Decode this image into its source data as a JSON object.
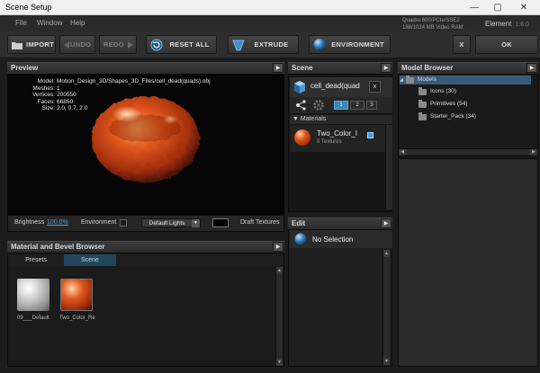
{
  "window": {
    "title": "Scene Setup",
    "minimize": "—",
    "maximize": "▢",
    "close": "✕"
  },
  "menu": [
    "File",
    "Window",
    "Help"
  ],
  "gpu": {
    "line1": "Quadro 600/PCIe/SSE2",
    "line2": "188/1024 MB Video RAM"
  },
  "element": {
    "name": "Element",
    "version": "1.6.0"
  },
  "toolbar": {
    "import": "IMPORT",
    "undo": "UNDO",
    "redo": "REDO",
    "reset_all": "RESET ALL",
    "extrude": "EXTRUDE",
    "environment": "ENVIRONMENT",
    "x": "X",
    "ok": "OK"
  },
  "preview": {
    "title": "Preview",
    "info": [
      {
        "k": "Model:",
        "v": "Motion_Design_3D/Shapes_3D_Files/cell_dead(quads).obj"
      },
      {
        "k": "Meshes:",
        "v": "1"
      },
      {
        "k": "Vertices:",
        "v": "200550"
      },
      {
        "k": "Faces:",
        "v": "66850"
      },
      {
        "k": "Size:",
        "v": "2.0, 0.7, 2.0"
      }
    ],
    "brightness_label": "Brightness",
    "brightness_value": "100.0%",
    "environment_label": "Environment",
    "lights": "Default Lights",
    "draft_textures": "Draft Textures"
  },
  "material_browser": {
    "title": "Material and Bevel Browser",
    "tabs": [
      "Presets",
      "Scene"
    ],
    "active_tab": "Scene",
    "items": [
      {
        "label": "09___Default"
      },
      {
        "label": "Two_Color_Re"
      }
    ]
  },
  "scene": {
    "title": "Scene",
    "object_name": "cell_dead(quad",
    "close": "x",
    "segments": [
      "1",
      "2",
      "3"
    ],
    "materials_label": "Materials",
    "material": {
      "name": "Two_Color_I",
      "sub": "0 Textures"
    }
  },
  "edit": {
    "title": "Edit",
    "status": "No Selection"
  },
  "model_browser": {
    "title": "Model Browser",
    "root": "Models",
    "children": [
      "Icons (30)",
      "Primitives (54)",
      "Starter_Pack (34)"
    ]
  },
  "colors": {
    "accent": "#3a87b8",
    "tab_active": "#23465e",
    "link": "#4ea0dd"
  }
}
